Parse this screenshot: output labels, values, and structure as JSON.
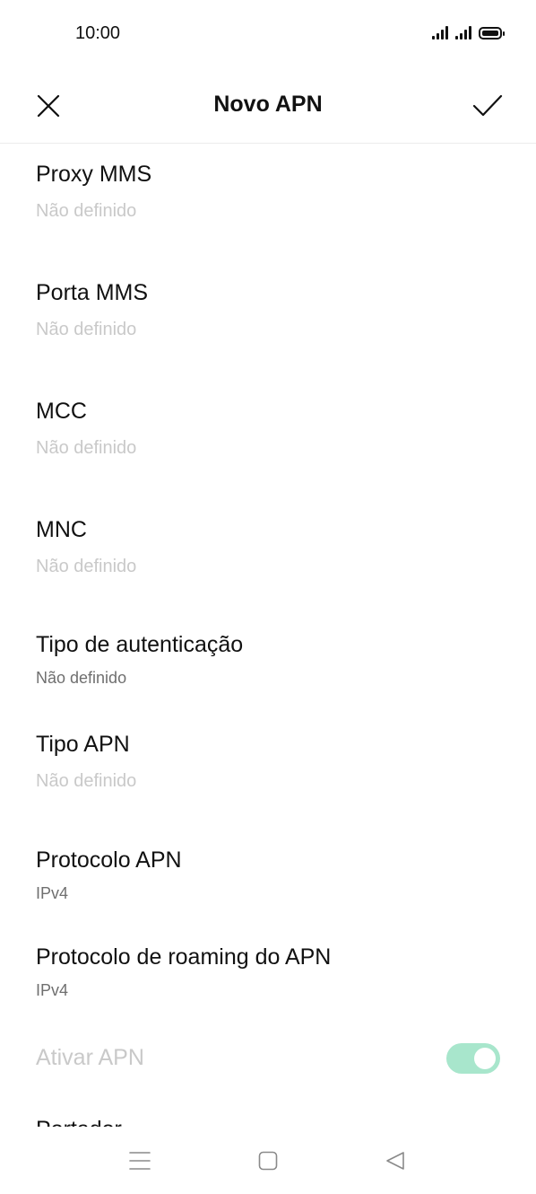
{
  "status_bar": {
    "time": "10:00",
    "icons": [
      "signal-icon",
      "signal-icon",
      "battery-icon"
    ]
  },
  "toolbar": {
    "title": "Novo APN",
    "close_icon": "close-icon",
    "confirm_icon": "check-icon"
  },
  "settings": {
    "proxy_mms": {
      "label": "Proxy MMS",
      "value": "Não definido"
    },
    "porta_mms": {
      "label": "Porta MMS",
      "value": "Não definido"
    },
    "mcc": {
      "label": "MCC",
      "value": "Não definido"
    },
    "mnc": {
      "label": "MNC",
      "value": "Não definido"
    },
    "tipo_autenticacao": {
      "label": "Tipo de autenticação",
      "value": "Não definido"
    },
    "tipo_apn": {
      "label": "Tipo APN",
      "value": "Não definido"
    },
    "protocolo_apn": {
      "label": "Protocolo APN",
      "value": "IPv4"
    },
    "protocolo_roaming": {
      "label": "Protocolo de roaming do APN",
      "value": "IPv4"
    },
    "ativar_apn": {
      "label": "Ativar APN",
      "enabled": true
    },
    "portador": {
      "label": "Portador"
    }
  },
  "colors": {
    "accent_toggle": "#a8e6cc",
    "hint_text": "#c9c9c9",
    "secondary_text": "#6f6f6f"
  },
  "nav_bar": {
    "icons": [
      "menu-icon",
      "home-icon",
      "back-icon"
    ]
  }
}
